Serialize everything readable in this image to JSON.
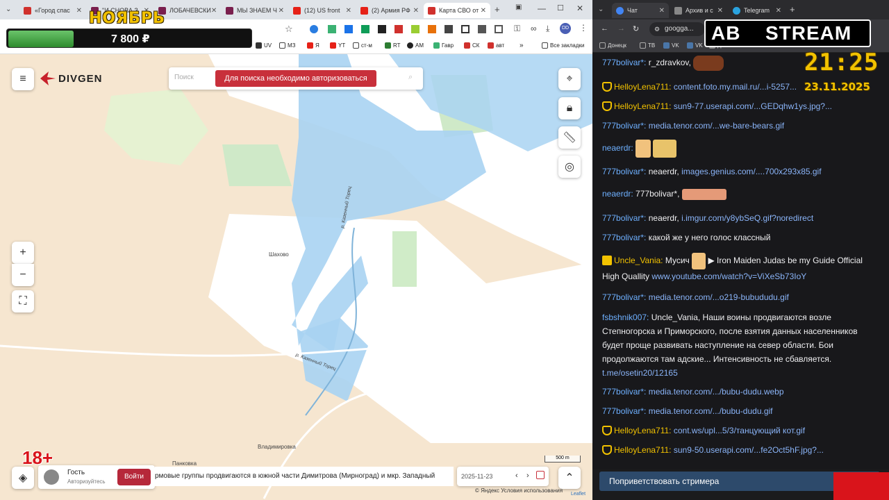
{
  "left_browser": {
    "tabs": [
      {
        "label": "«Город спас",
        "color": "#d0312d"
      },
      {
        "label": "\"И СНОВА З",
        "color": "#7a1f4d"
      },
      {
        "label": "ЛОБАЧЕВСКИ",
        "color": "#7a1f4d"
      },
      {
        "label": "МЫ ЗНАЕМ Ч",
        "color": "#7a1f4d"
      },
      {
        "label": "(12) US front",
        "color": "#e62117"
      },
      {
        "label": "(2) Армия РФ",
        "color": "#e62117"
      },
      {
        "label": "Карта СВО от",
        "color": "#d0312d"
      }
    ],
    "bookmarks": [
      "UV",
      "МЗ",
      "Я",
      "YT",
      "ст-м",
      "RT",
      "AM",
      "Гавр",
      "СК",
      "авт"
    ],
    "all_bookmarks_label": "Все закладки"
  },
  "overlay": {
    "month": "НОЯБРЬ",
    "price": "7 800 ₽",
    "age_rating": "18+",
    "price_progress_fraction": 0.27
  },
  "map": {
    "logo": "DIVGEN",
    "search_placeholder": "Поиск",
    "auth_notice": "Для поиска необходимо авторизоваться",
    "place_labels": [
      "Шахово",
      "Владимировка",
      "Панковка"
    ],
    "river_labels": [
      "р. Казенный Торец",
      "р. Казенный Торец"
    ],
    "scale_label": "500 m",
    "user_name": "Гость",
    "user_status": "Авторизуйтесь",
    "login_label": "Войти",
    "news_ticker": "рмовые группы продвигаются в южной части Димитрова (Мирноград) и мкр. Западный",
    "date_value": "2025-11-23",
    "attribution": "© Яндекс Условия использования",
    "leaflet_label": "Leaflet",
    "zoom_in": "+",
    "zoom_out": "−"
  },
  "right_browser": {
    "tabs": [
      {
        "label": "Чат"
      },
      {
        "label": "Архив и с"
      },
      {
        "label": "Telegram"
      }
    ],
    "address": "googga...",
    "bookmarks": [
      "Донецк",
      "ТВ",
      "VK",
      "VK",
      "Д"
    ]
  },
  "stream_overlay": {
    "ab": "АВ",
    "stream": "STREAM",
    "time": "21:25",
    "date": "23.11.2025"
  },
  "chat": {
    "messages": [
      {
        "user": "777bolivar*:",
        "text": "r_zdravkov,",
        "link": ""
      },
      {
        "user": "HelloyLena711:",
        "text": "",
        "link": "content.foto.my.mail.ru/...i-5257..."
      },
      {
        "user": "HelloyLena711:",
        "text": "",
        "link": "sun9-77.userapi.com/...GEDqhw1ys.jpg?..."
      },
      {
        "user": "777bolivar*:",
        "text": "",
        "link": "media.tenor.com/...we-bare-bears.gif"
      },
      {
        "user": "neaerdr:",
        "text": "",
        "link": ""
      },
      {
        "user": "777bolivar*:",
        "text": "neaerdr,",
        "link": "images.genius.com/....700x293x85.gif"
      },
      {
        "user": "neaerdr:",
        "text": "777bolivar*,",
        "link": ""
      },
      {
        "user": "777bolivar*:",
        "text": "neaerdr,",
        "link": "i.imgur.com/y8ybSeQ.gif?noredirect"
      },
      {
        "user": "777bolivar*:",
        "text": "какой же у него голос классный",
        "link": ""
      },
      {
        "user": "Uncle_Vania:",
        "text": "Мусич",
        "text2": "▶ Iron Maiden Judas be my Guide Official High Quallity",
        "link": "www.youtube.com/watch?v=ViXeSb73IoY"
      },
      {
        "user": "777bolivar*:",
        "text": "",
        "link": "media.tenor.com/...o219-bubududu.gif"
      },
      {
        "user": "fsbshnik007:",
        "text": "Uncle_Vania, Наши воины продвигаются возле Степногорска и Приморского, после взятия данных населенников будет проще развивать наступление на север области. Бои продолжаются там адские... Интенсивность не сбавляется.",
        "link": "t.me/osetin20/12165"
      },
      {
        "user": "777bolivar*:",
        "text": "",
        "link": "media.tenor.com/.../bubu-dudu.webp"
      },
      {
        "user": "777bolivar*:",
        "text": "",
        "link": "media.tenor.com/.../bubu-dudu.gif"
      },
      {
        "user": "HelloyLena711:",
        "text": "",
        "link": "cont.ws/upl...5/3/танцующий кот.gif"
      },
      {
        "user": "HelloyLena711:",
        "text": "",
        "link": "sun9-50.userapi.com/...fe2Oct5hF.jpg?..."
      }
    ],
    "greet_label": "Поприветствовать стримера"
  },
  "colors": {
    "accent_red": "#d0312d",
    "chat_user": "#6eb0ff",
    "gold": "#f2c200"
  }
}
